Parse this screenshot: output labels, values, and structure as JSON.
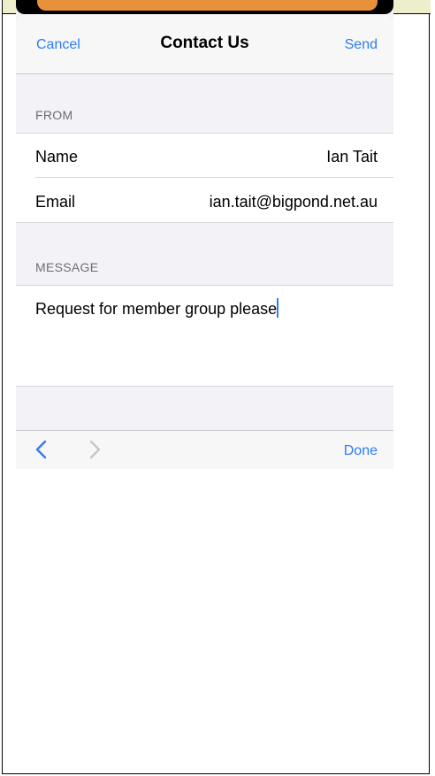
{
  "navbar": {
    "cancel_label": "Cancel",
    "title": "Contact Us",
    "send_label": "Send"
  },
  "from_section": {
    "header": "FROM",
    "name_label": "Name",
    "name_value": "Ian Tait",
    "email_label": "Email",
    "email_value": "ian.tait@bigpond.net.au"
  },
  "message_section": {
    "header": "MESSAGE",
    "text": "Request for member group please"
  },
  "toolbar": {
    "prev_icon": "chevron-left-icon",
    "next_icon": "chevron-right-icon",
    "done_label": "Done"
  },
  "colors": {
    "accent": "#2f7cf6",
    "banner": "#e8913a",
    "background": "#f2f2f7"
  }
}
